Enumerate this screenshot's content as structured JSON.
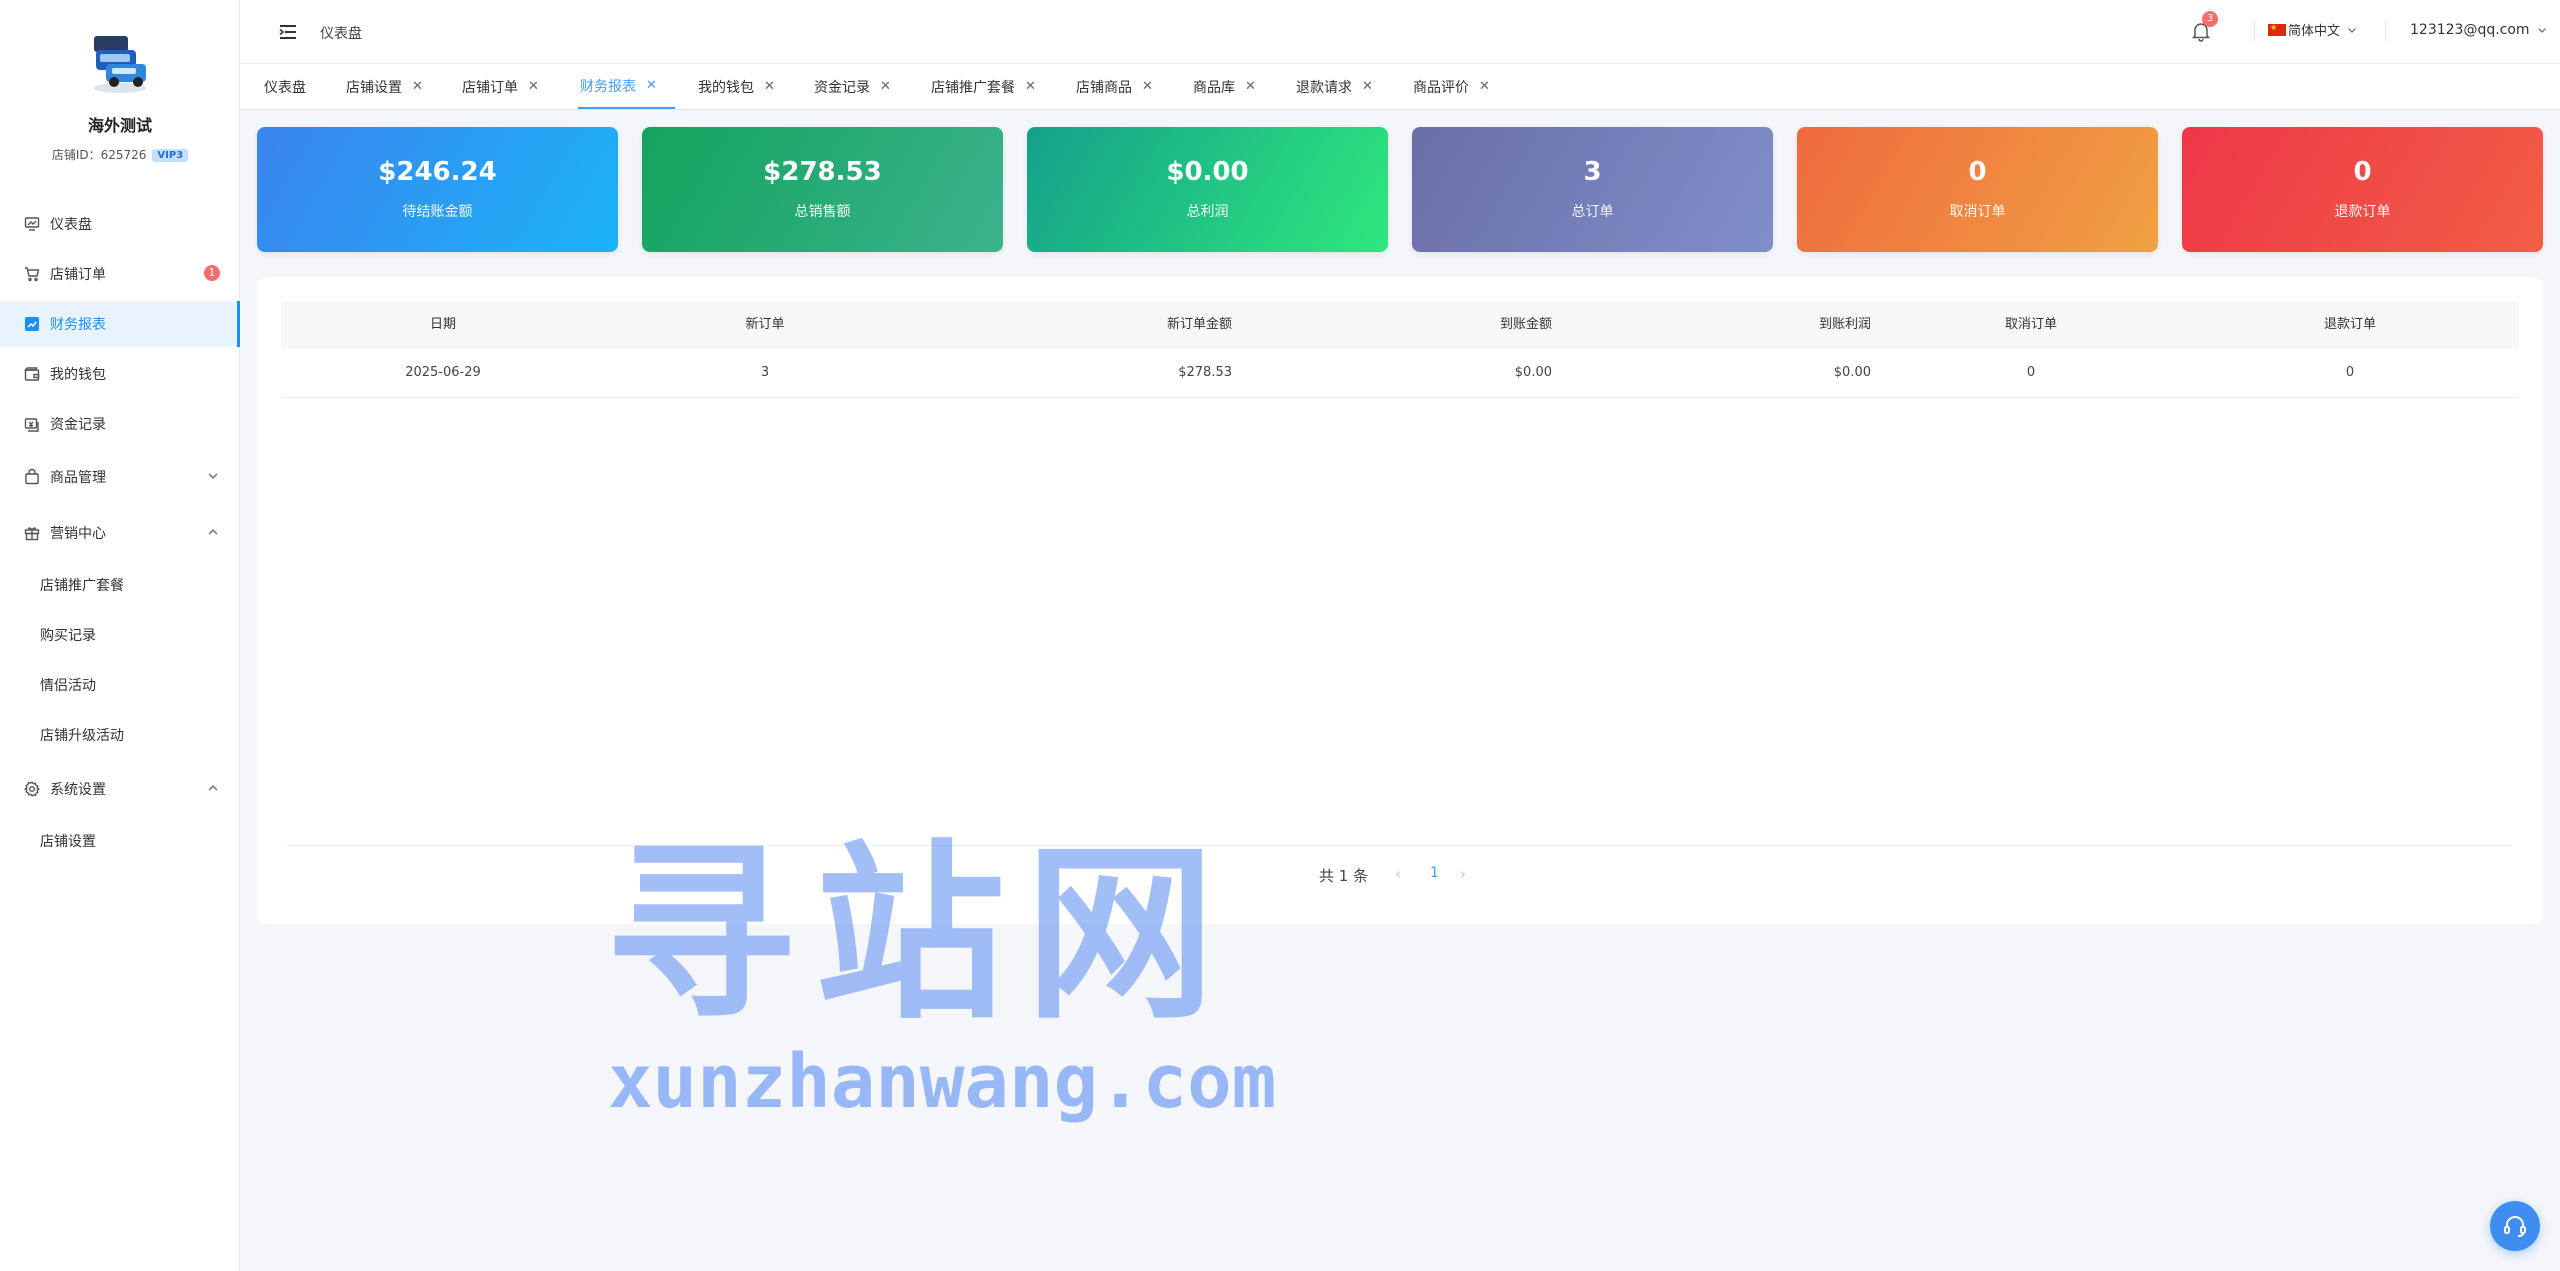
{
  "sidebar": {
    "shop_name": "海外测试",
    "shop_id": "店铺ID：625726",
    "vip": "VIP3",
    "items": [
      {
        "label": "仪表盘",
        "icon": "dashboard-icon"
      },
      {
        "label": "店铺订单",
        "icon": "cart-icon",
        "badge": "1"
      },
      {
        "label": "财务报表",
        "icon": "chart-icon"
      },
      {
        "label": "我的钱包",
        "icon": "wallet-icon"
      },
      {
        "label": "资金记录",
        "icon": "money-record-icon"
      },
      {
        "label": "商品管理",
        "icon": "bag-icon"
      },
      {
        "label": "营销中心",
        "icon": "gift-icon"
      },
      {
        "label": "店铺推广套餐"
      },
      {
        "label": "购买记录"
      },
      {
        "label": "情侣活动"
      },
      {
        "label": "店铺升级活动"
      },
      {
        "label": "系统设置",
        "icon": "gear-icon"
      },
      {
        "label": "店铺设置"
      }
    ]
  },
  "header": {
    "breadcrumb": "仪表盘",
    "notif_count": "3",
    "language": "简体中文",
    "user_email": "123123@qq.com"
  },
  "tabs": [
    "仪表盘",
    "店铺设置",
    "店铺订单",
    "财务报表",
    "我的钱包",
    "资金记录",
    "店铺推广套餐",
    "店铺商品",
    "商品库",
    "退款请求",
    "商品评价"
  ],
  "active_tab": "财务报表",
  "stats": [
    {
      "value": "$246.24",
      "label": "待结账金额",
      "from": "#3a84ee",
      "to": "#1bb3f7"
    },
    {
      "value": "$278.53",
      "label": "总销售额",
      "from": "#13a35e",
      "to": "#3bb38c"
    },
    {
      "value": "$0.00",
      "label": "总利润",
      "from": "#14a08b",
      "to": "#2ee87c"
    },
    {
      "value": "3",
      "label": "总订单",
      "from": "#6a6ea9",
      "to": "#808fc8"
    },
    {
      "value": "0",
      "label": "取消订单",
      "from": "#ef6a3e",
      "to": "#f0a142"
    },
    {
      "value": "0",
      "label": "退款订单",
      "from": "#ee3748",
      "to": "#f25e45"
    }
  ],
  "table": {
    "columns": [
      "日期",
      "新订单",
      "新订单金额",
      "到账金额",
      "到账利润",
      "取消订单",
      "退款订单"
    ],
    "rows": [
      [
        "2025-06-29",
        "3",
        "$278.53",
        "$0.00",
        "$0.00",
        "0",
        "0"
      ]
    ]
  },
  "pagination": {
    "total": "共 1 条",
    "current": "1"
  },
  "watermark": {
    "cn": "寻站网",
    "en": "xunzhanwang.com"
  }
}
